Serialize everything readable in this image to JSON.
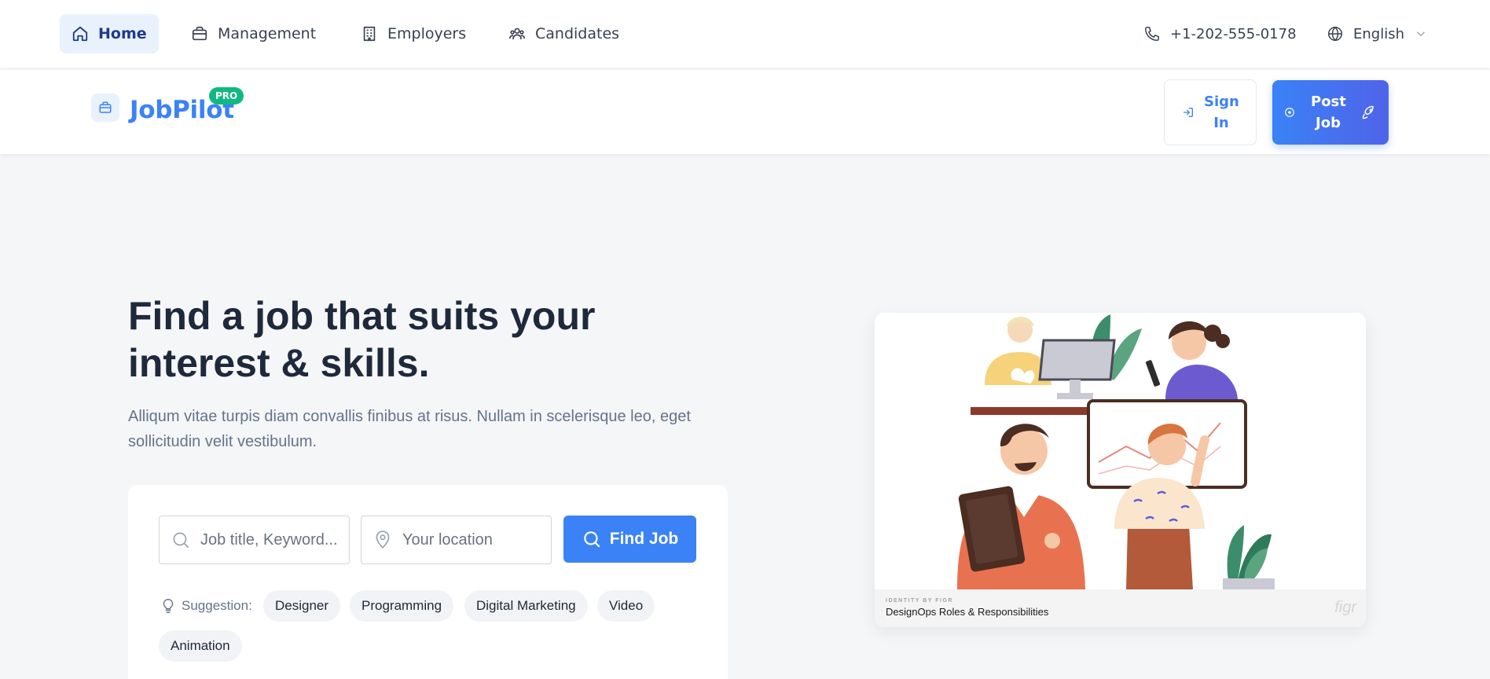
{
  "topnav": {
    "items": [
      {
        "label": "Home",
        "icon": "home-icon",
        "active": true
      },
      {
        "label": "Management",
        "icon": "briefcase-icon"
      },
      {
        "label": "Employers",
        "icon": "building-icon"
      },
      {
        "label": "Candidates",
        "icon": "users-icon"
      }
    ],
    "phone": "+1-202-555-0178",
    "language": "English"
  },
  "brand": {
    "name": "JobPilot",
    "badge": "PRO",
    "signin_label": "Sign In",
    "post_label": "Post Job"
  },
  "hero": {
    "title": "Find a job that suits your interest & skills.",
    "subtitle": "Alliqum vitae turpis diam convallis finibus at risus. Nullam in scelerisque leo, eget sollicitudin velit vestibulum."
  },
  "search": {
    "keyword_placeholder": "Job title, Keyword...",
    "location_placeholder": "Your location",
    "button_label": "Find Job",
    "suggestion_label": "Suggestion:",
    "suggestions": [
      "Designer",
      "Programming",
      "Digital Marketing",
      "Video",
      "Animation"
    ]
  },
  "illustration": {
    "overline": "IDENTITY BY FIGR",
    "caption": "DesignOps Roles & Responsibilities",
    "watermark": "figr"
  },
  "colors": {
    "accent": "#3b82f6",
    "badge": "#10b981",
    "heading": "#1e293b",
    "muted": "#64748b"
  }
}
